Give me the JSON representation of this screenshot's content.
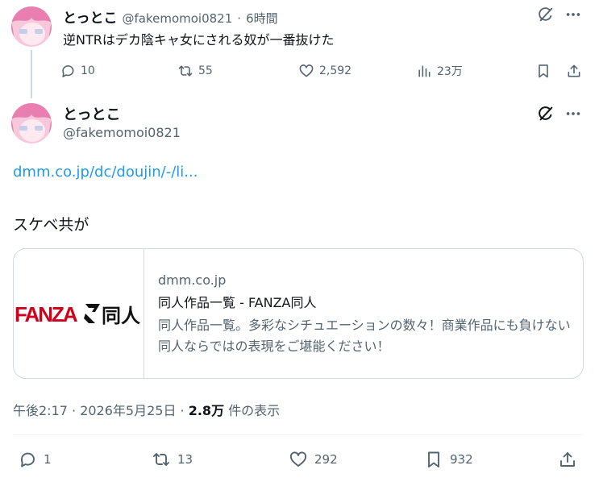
{
  "tweet1": {
    "name": "とっとこ",
    "handle": "@fakemomoi0821",
    "separator": "·",
    "time": "6時間",
    "text": "逆NTRはデカ陰キャ女にされる奴が一番抜けた",
    "stats": {
      "replies": "10",
      "retweets": "55",
      "likes": "2,592",
      "views": "23万"
    }
  },
  "tweet2": {
    "name": "とっとこ",
    "handle": "@fakemomoi0821",
    "link": "dmm.co.jp/dc/doujin/-/li...",
    "text": "スケベ共が",
    "card": {
      "domain": "dmm.co.jp",
      "title": "同人作品一覧 - FANZA同人",
      "description": "同人作品一覧。多彩なシチュエーションの数々！商業作品にも負けない同人ならではの表現をご堪能ください！",
      "logo_text_left": "FANZA",
      "logo_text_right": "同人",
      "logo_color": "#d0021b"
    },
    "timestamp": "午後2:17 · 2026年5月25日 · ",
    "views_count": "2.8万",
    "views_label": " 件の表示",
    "stats": {
      "replies": "1",
      "retweets": "13",
      "likes": "292",
      "bookmarks": "932"
    }
  },
  "colors": {
    "link": "#1d9bf0",
    "muted": "#536471",
    "text": "#0f1419",
    "border": "#cfd9de"
  },
  "icons": [
    "reply-icon",
    "retweet-icon",
    "like-icon",
    "views-icon",
    "bookmark-icon",
    "share-icon",
    "grok-icon",
    "more-icon"
  ]
}
